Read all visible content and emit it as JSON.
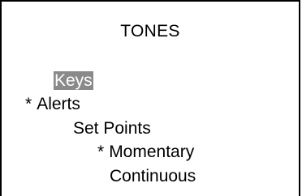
{
  "screen": {
    "title": "TONES",
    "items": [
      {
        "label": "Keys",
        "marker": "",
        "selected": true
      },
      {
        "label": "Alerts",
        "marker": "*",
        "selected": false
      },
      {
        "label": "Set Points",
        "marker": "",
        "selected": false
      },
      {
        "label": "Momentary",
        "marker": "*",
        "selected": false
      },
      {
        "label": "Continuous",
        "marker": "",
        "selected": false
      }
    ]
  },
  "colors": {
    "highlight_background": "#8a8a8a",
    "highlight_text": "#ffffff",
    "text": "#000000",
    "background": "#ffffff"
  }
}
